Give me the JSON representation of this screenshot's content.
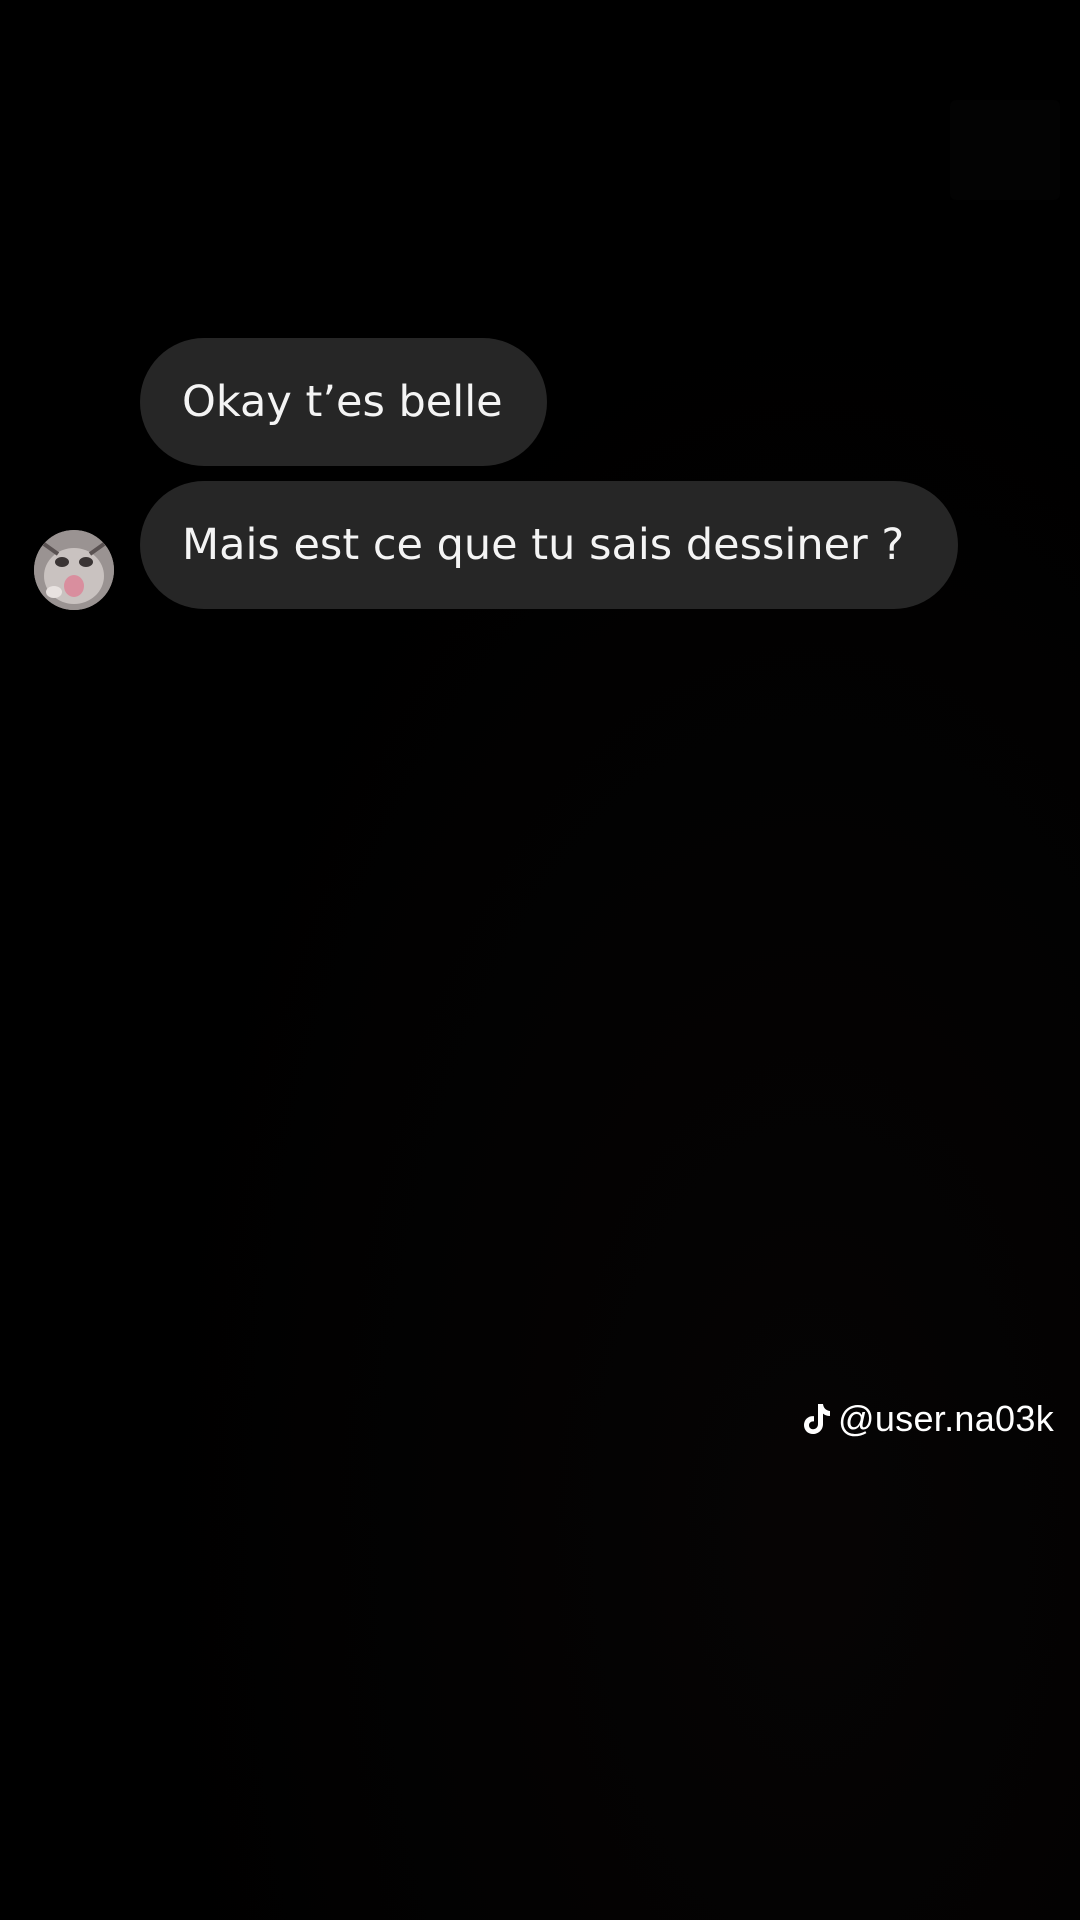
{
  "messages": [
    {
      "text": "Okay t’es belle"
    },
    {
      "text": "Mais est ce que tu sais dessiner ?"
    }
  ],
  "avatar": {
    "icon": "cat-avatar"
  },
  "watermark": {
    "handle": "@user.na03k",
    "icon": "tiktok-icon"
  },
  "colors": {
    "background": "#000000",
    "bubble": "#262626",
    "text": "#f4f4f4"
  }
}
